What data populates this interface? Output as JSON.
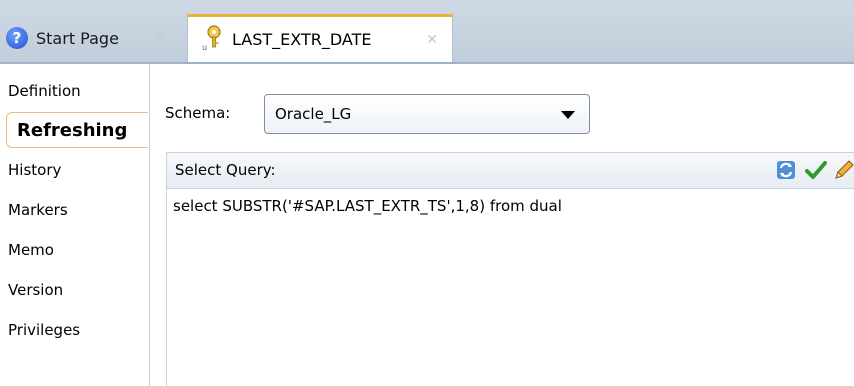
{
  "tabs": [
    {
      "label": "Start Page",
      "icon": "help-icon",
      "active": false
    },
    {
      "label": "LAST_EXTR_DATE",
      "icon": "variable-key-icon",
      "active": true
    }
  ],
  "nav": {
    "items": [
      {
        "label": "Definition"
      },
      {
        "label": "Refreshing"
      },
      {
        "label": "History"
      },
      {
        "label": "Markers"
      },
      {
        "label": "Memo"
      },
      {
        "label": "Version"
      },
      {
        "label": "Privileges"
      }
    ],
    "selected": "Refreshing"
  },
  "schema": {
    "label": "Schema:",
    "value": "Oracle_LG"
  },
  "query": {
    "title": "Select Query:",
    "text": "select SUBSTR('#SAP.LAST_EXTR_TS',1,8) from dual"
  },
  "colors": {
    "accent": "#e6b43c",
    "tabbar": "#c7d2df",
    "check": "#2e9b2e"
  }
}
